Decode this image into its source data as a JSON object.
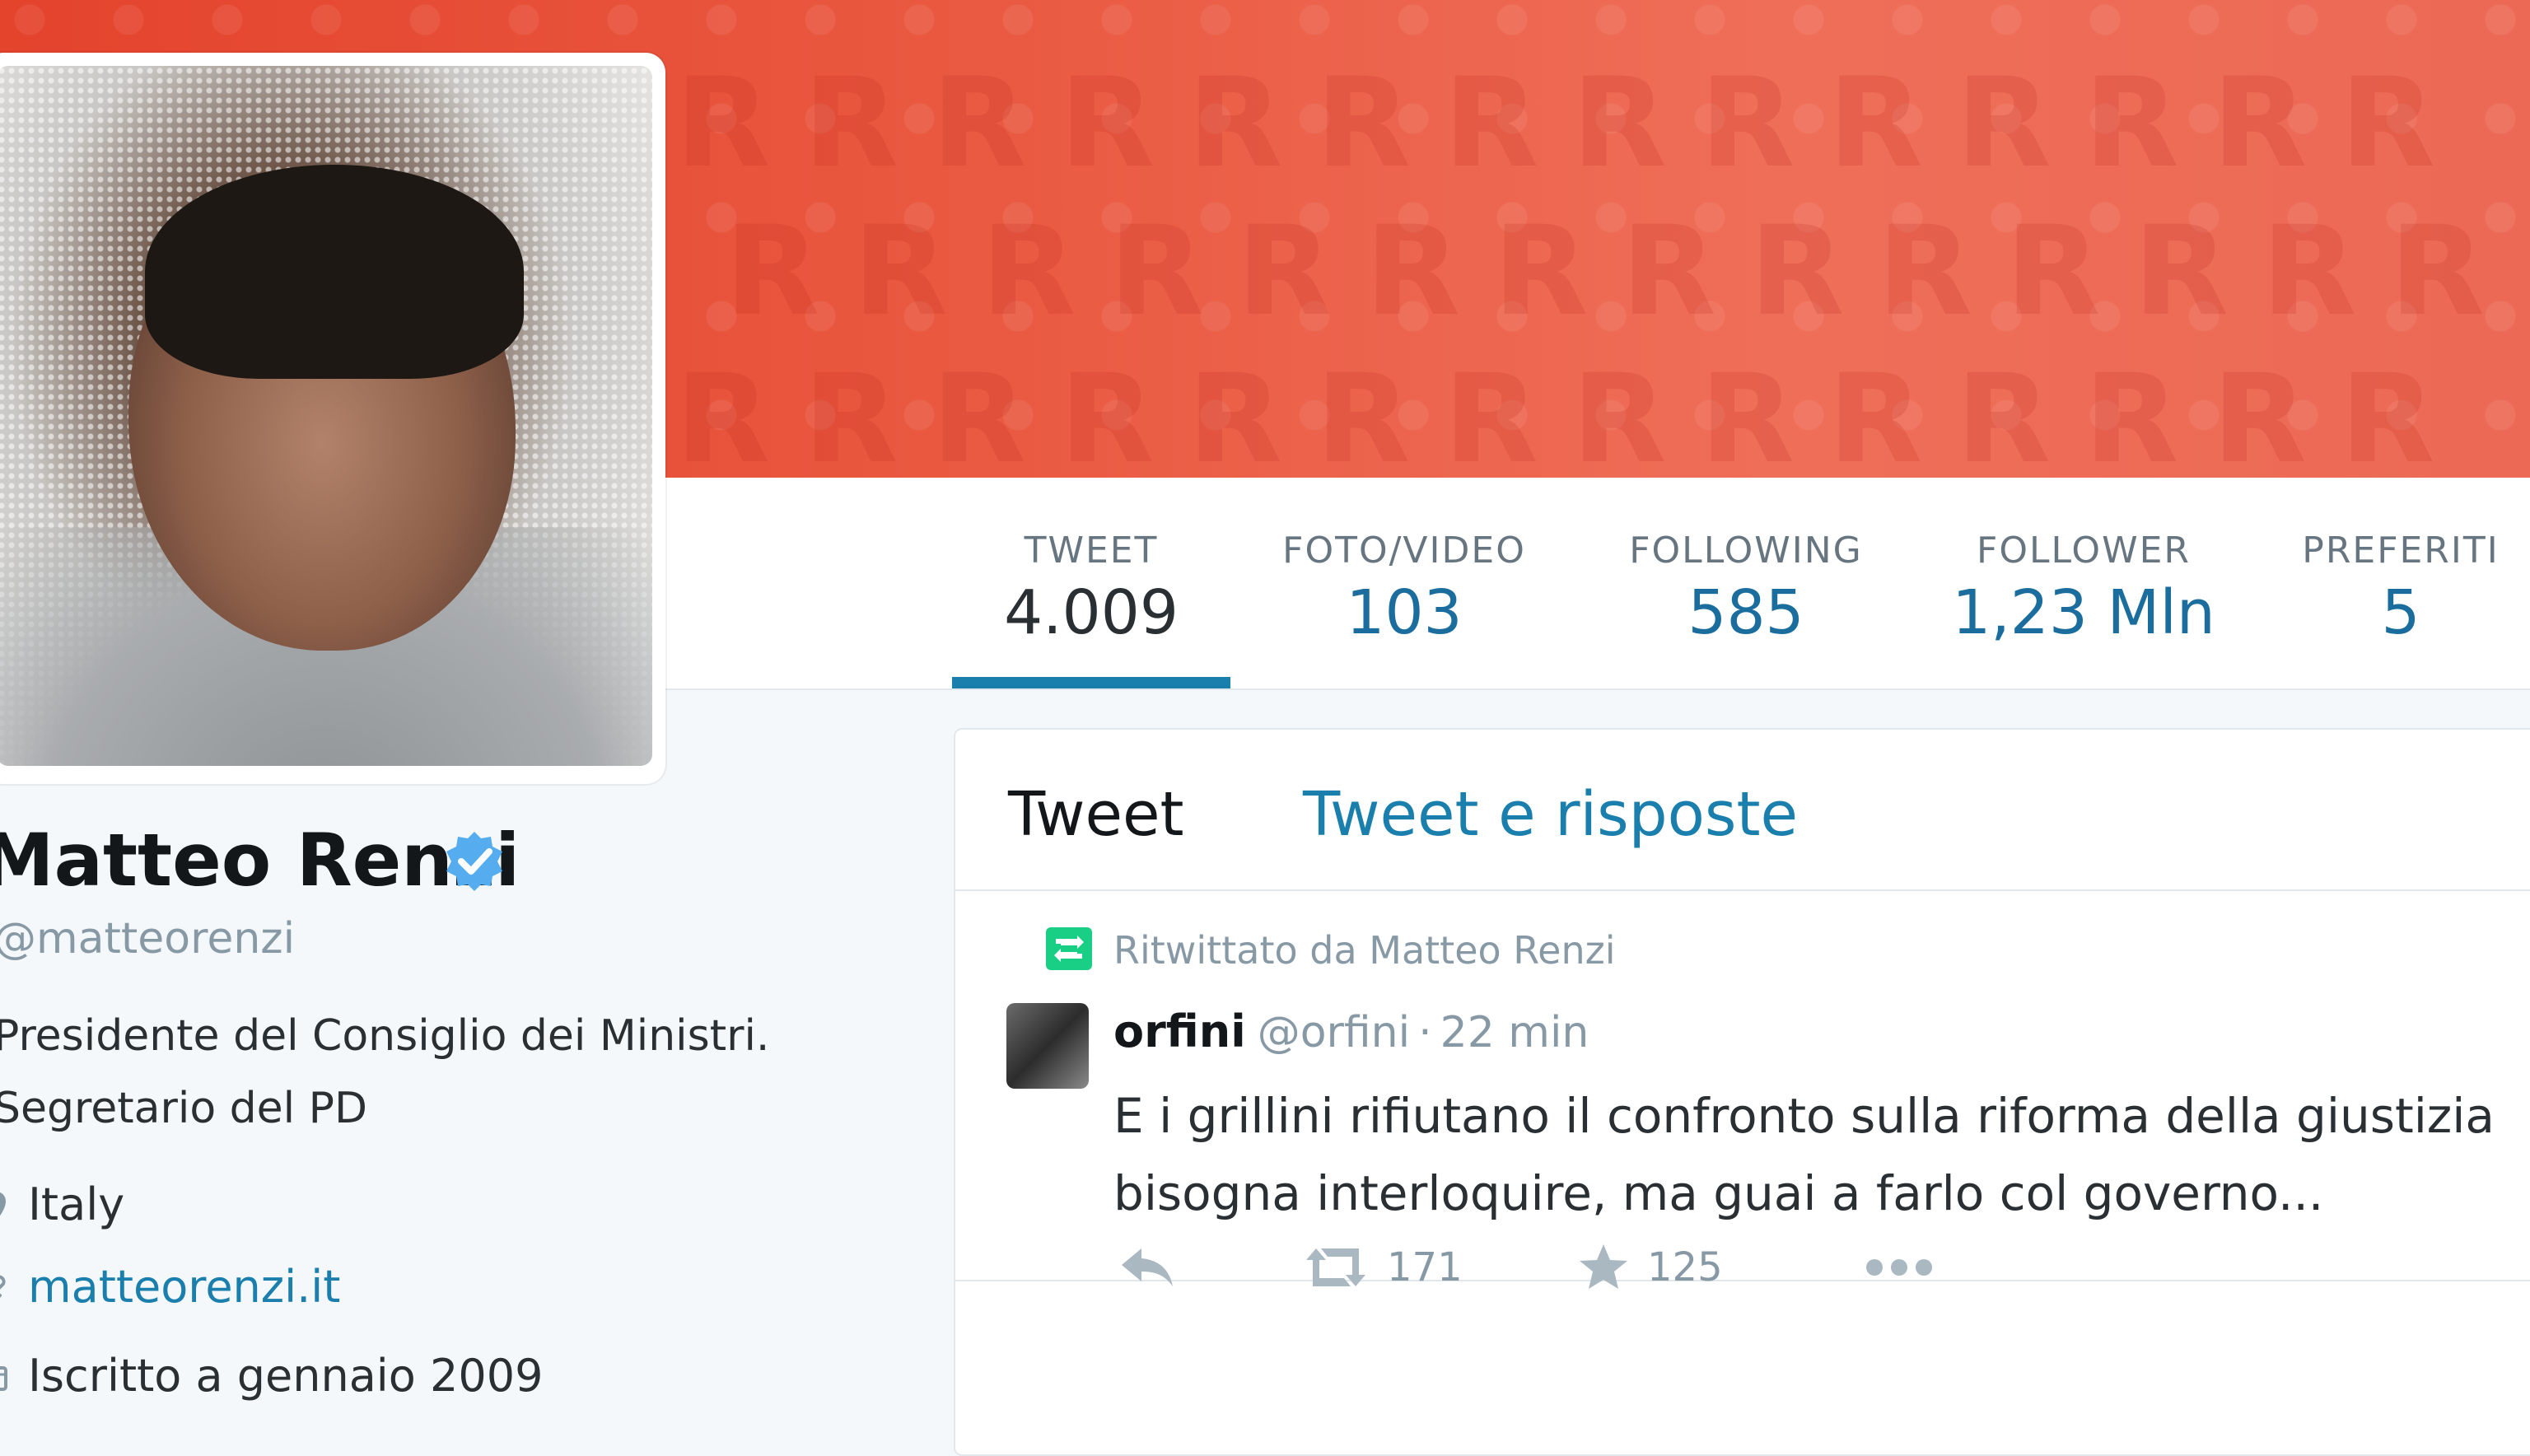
{
  "header": {
    "banner_pattern": "R"
  },
  "profile": {
    "name": "Matteo Renzi",
    "handle": "@matteorenzi",
    "bio": [
      "Presidente del Consiglio dei Ministri.",
      "Segretario del PD"
    ],
    "location": "Italy",
    "website": "matteorenzi.it",
    "joined": "Iscritto a gennaio 2009",
    "verified": true,
    "verified_color": "#55acee"
  },
  "stats": [
    {
      "label": "TWEET",
      "value": "4.009",
      "active": true
    },
    {
      "label": "FOTO/VIDEO",
      "value": "103",
      "active": false
    },
    {
      "label": "FOLLOWING",
      "value": "585",
      "active": false
    },
    {
      "label": "FOLLOWER",
      "value": "1,23 Mln",
      "active": false
    },
    {
      "label": "PREFERITI",
      "value": "5",
      "active": false
    }
  ],
  "timeline": {
    "tabs": [
      {
        "label": "Tweet",
        "active": true
      },
      {
        "label": "Tweet e risposte",
        "active": false
      }
    ],
    "tweet": {
      "retweet_context": "Ritwittato da Matteo Renzi",
      "fullname": "orfini",
      "username": "@orfini",
      "separator": "·",
      "time": "22 min",
      "text": [
        "E i grillini rifiutano il confronto sulla riforma della giustizia",
        "bisogna interloquire, ma guai a farlo col governo..."
      ],
      "retweets": "171",
      "favorites": "125"
    }
  },
  "colors": {
    "banner": "#e9503a",
    "link": "#1b7fad",
    "retweet_green": "#19cf86",
    "muted": "#8899a6"
  }
}
